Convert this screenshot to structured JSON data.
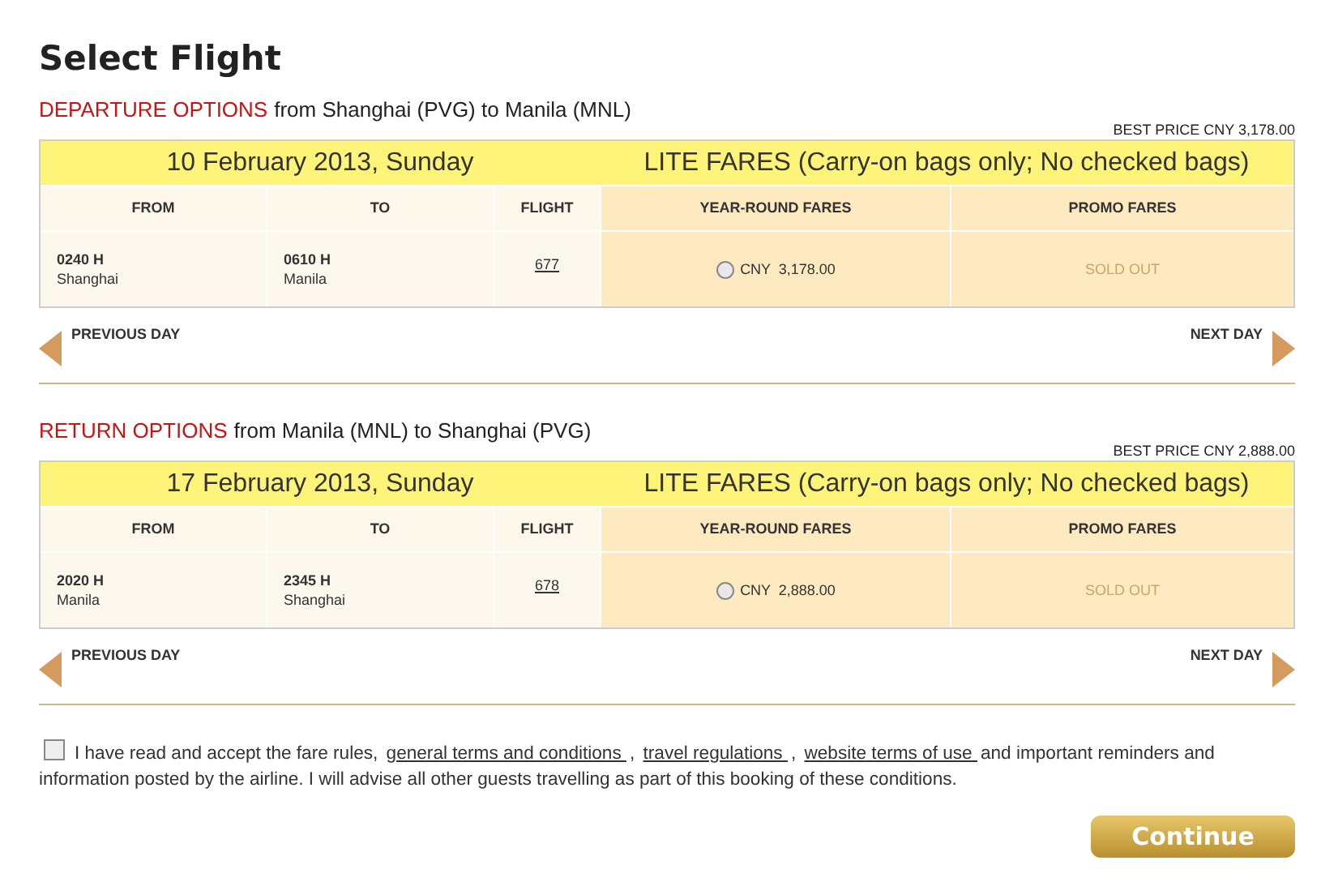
{
  "title": "Select Flight",
  "sections": [
    {
      "label": "DEPARTURE OPTIONS",
      "route": "from Shanghai (PVG) to Manila (MNL)",
      "best_price": "BEST PRICE CNY 3,178.00",
      "date": "10 February 2013, Sunday",
      "fares_title": "LITE FARES (Carry-on bags only; No checked bags)",
      "columns": [
        "FROM",
        "TO",
        "FLIGHT",
        "YEAR-ROUND FARES",
        "PROMO FARES"
      ],
      "flights": [
        {
          "dep_time": "0240 H",
          "dep_city": "Shanghai",
          "arr_time": "0610 H",
          "arr_city": "Manila",
          "flight": "677",
          "fare": "CNY  3,178.00",
          "selected": false,
          "promo": "SOLD OUT"
        }
      ],
      "prev": "PREVIOUS DAY",
      "next": "NEXT DAY"
    },
    {
      "label": "RETURN OPTIONS",
      "route": "from Manila (MNL) to Shanghai (PVG)",
      "best_price": "BEST PRICE CNY 2,888.00",
      "date": "17 February 2013, Sunday",
      "fares_title": "LITE FARES (Carry-on bags only; No checked bags)",
      "columns": [
        "FROM",
        "TO",
        "FLIGHT",
        "YEAR-ROUND FARES",
        "PROMO FARES"
      ],
      "flights": [
        {
          "dep_time": "2020 H",
          "dep_city": "Manila",
          "arr_time": "2345 H",
          "arr_city": "Shanghai",
          "flight": "678",
          "fare": "CNY  2,888.00",
          "selected": false,
          "promo": "SOLD OUT"
        }
      ],
      "prev": "PREVIOUS DAY",
      "next": "NEXT DAY"
    }
  ],
  "agreement": {
    "checked": false,
    "parts": [
      {
        "kind": "text",
        "text": "I have read and accept the fare rules, "
      },
      {
        "kind": "link",
        "text": "general terms and conditions "
      },
      {
        "kind": "text",
        "text": ", "
      },
      {
        "kind": "link",
        "text": "travel regulations "
      },
      {
        "kind": "text",
        "text": ", "
      },
      {
        "kind": "link",
        "text": "website terms of use "
      },
      {
        "kind": "text",
        "text": " and important reminders and information posted by the airline. I will advise all other guests travelling as part of this booking of these conditions."
      }
    ]
  },
  "continue_button": "Continue"
}
